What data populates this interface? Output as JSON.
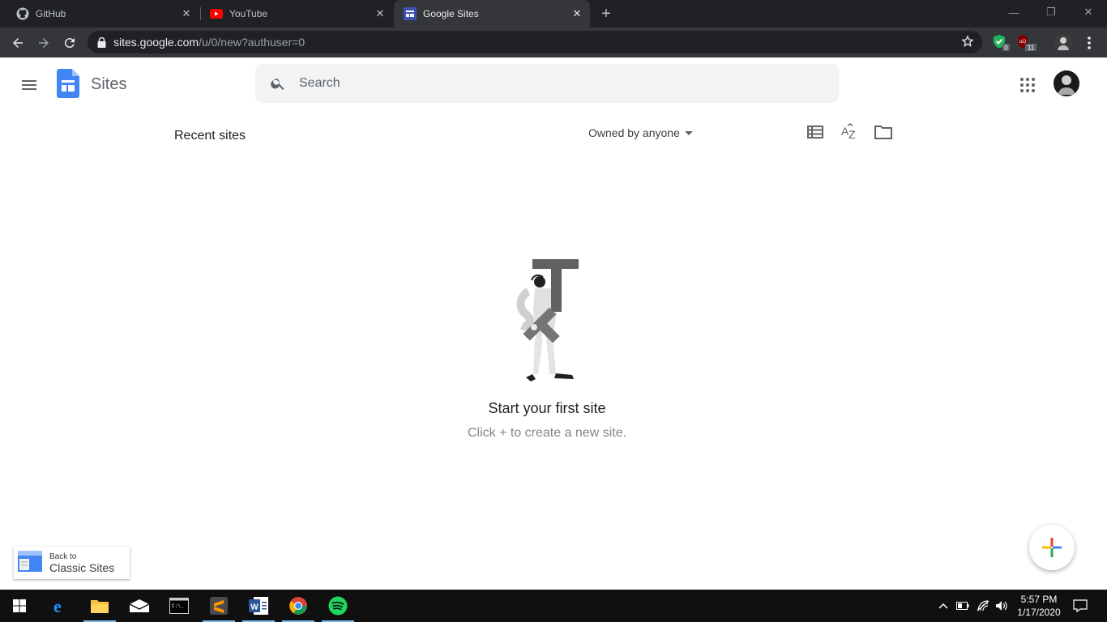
{
  "browser": {
    "tabs": [
      {
        "title": "GitHub",
        "icon": "github-icon"
      },
      {
        "title": "YouTube",
        "icon": "youtube-icon"
      },
      {
        "title": "Google Sites",
        "icon": "google-sites-icon",
        "active": true
      }
    ],
    "url_domain": "sites.google.com",
    "url_path": "/u/0/new?authuser=0",
    "extension_badges": {
      "shield": "0",
      "ublock": "11"
    }
  },
  "app": {
    "name": "Sites",
    "search_placeholder": "Search",
    "accent_color": "#4285f4"
  },
  "content": {
    "section_title": "Recent sites",
    "owner_filter": "Owned by anyone",
    "empty_title": "Start your first site",
    "empty_subtitle": "Click + to create a new site."
  },
  "classic": {
    "line1": "Back to",
    "line2": "Classic Sites"
  },
  "taskbar": {
    "time": "5:57 PM",
    "date": "1/17/2020"
  }
}
